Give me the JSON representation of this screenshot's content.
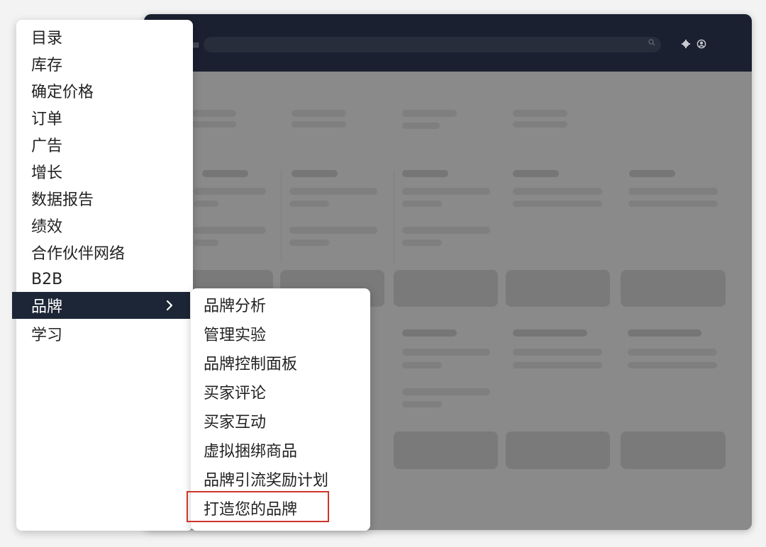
{
  "main_menu": {
    "items": [
      {
        "label": "目录"
      },
      {
        "label": "库存"
      },
      {
        "label": "确定价格"
      },
      {
        "label": "订单"
      },
      {
        "label": "广告"
      },
      {
        "label": "增长"
      },
      {
        "label": "数据报告"
      },
      {
        "label": "绩效"
      },
      {
        "label": "合作伙伴网络"
      },
      {
        "label": "B2B"
      },
      {
        "label": "品牌",
        "active": true,
        "icon": "chevron-right-icon"
      },
      {
        "label": "学习"
      }
    ]
  },
  "brand_submenu": {
    "items": [
      {
        "label": "品牌分析"
      },
      {
        "label": "管理实验"
      },
      {
        "label": "品牌控制面板"
      },
      {
        "label": "买家评论"
      },
      {
        "label": "买家互动"
      },
      {
        "label": "虚拟捆绑商品"
      },
      {
        "label": "品牌引流奖励计划"
      },
      {
        "label": "打造您的品牌",
        "highlighted": true
      }
    ]
  },
  "header": {
    "icons": [
      "menu-icon",
      "search-icon",
      "gear-icon",
      "account-icon"
    ]
  },
  "colors": {
    "header_bg": "#1a2030",
    "active_item_bg": "#1d2636",
    "highlight_border": "#d0342c",
    "overlay_gray": "#8a8a8a"
  }
}
